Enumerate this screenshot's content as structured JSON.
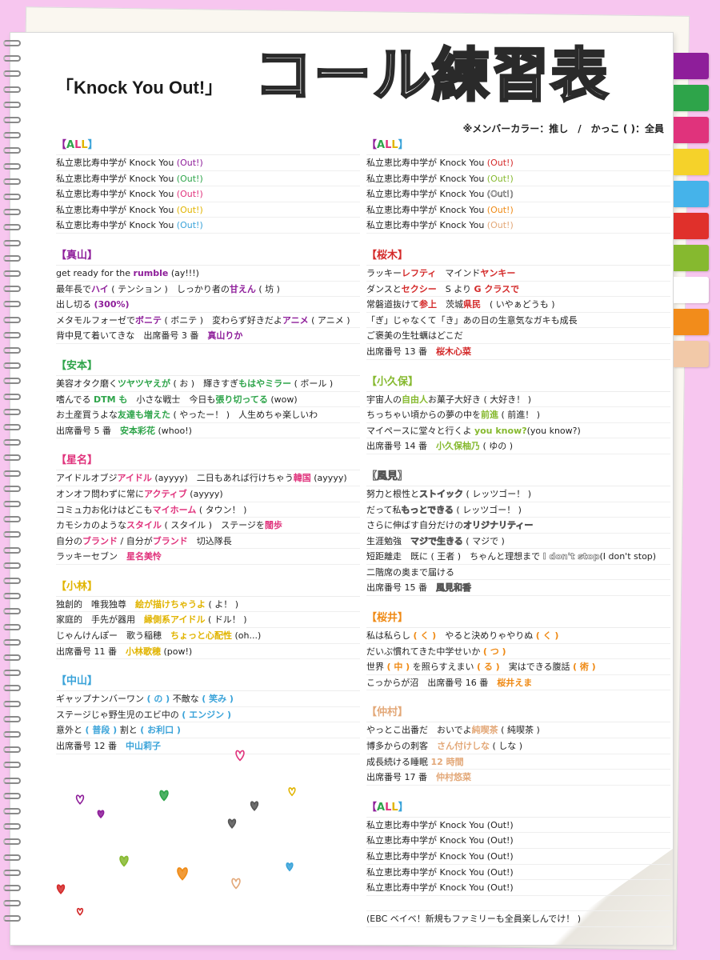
{
  "header": {
    "song": "「Knock You Out!」",
    "title": "コール練習表",
    "note": "※メンバーカラー：推し　/　かっこ ( )：全員"
  },
  "colors": {
    "purple": "#8e1e9a",
    "green": "#2ea44a",
    "pink": "#e0337c",
    "yellow": "#e1b400",
    "sky": "#3aa3d9",
    "red": "#d42a2a",
    "lgreen": "#86b92f",
    "white": "#ffffff",
    "orange": "#ef8a15",
    "peach": "#e3a878"
  },
  "tabs": [
    "#8e1e9a",
    "#2ea44a",
    "#e0337c",
    "#f5d22a",
    "#45b3ea",
    "#e0302b",
    "#86b92f",
    "#ffffff",
    "#f28c1b",
    "#f2c9a8"
  ],
  "left_sections": [
    {
      "title": "【ALL】",
      "title_color": "rainbow",
      "lines": [
        [
          {
            "t": "私立恵比寿中学が Knock You "
          },
          {
            "t": "(Out!)",
            "c": "purple"
          }
        ],
        [
          {
            "t": "私立恵比寿中学が Knock You "
          },
          {
            "t": "(Out!)",
            "c": "green"
          }
        ],
        [
          {
            "t": "私立恵比寿中学が Knock You "
          },
          {
            "t": "(Out!)",
            "c": "pink"
          }
        ],
        [
          {
            "t": "私立恵比寿中学が Knock You "
          },
          {
            "t": "(Out!)",
            "c": "yellow"
          }
        ],
        [
          {
            "t": "私立恵比寿中学が Knock You "
          },
          {
            "t": "(Out!)",
            "c": "sky"
          }
        ]
      ]
    },
    {
      "title": "【真山】",
      "title_color": "purple",
      "lines": [
        [
          {
            "t": "get ready for the "
          },
          {
            "t": "rumble",
            "c": "purple",
            "b": true
          },
          {
            "t": " (ay!!!)"
          }
        ],
        [
          {
            "t": "最年長で"
          },
          {
            "t": "ハイ",
            "c": "purple",
            "b": true
          },
          {
            "t": " ( テンション )　しっかり者の"
          },
          {
            "t": "甘えん",
            "c": "purple",
            "b": true
          },
          {
            "t": " ( 坊 )"
          }
        ],
        [
          {
            "t": "出し切る "
          },
          {
            "t": "(300%)",
            "c": "purple",
            "b": true
          }
        ],
        [
          {
            "t": "メタモルフォーゼで"
          },
          {
            "t": "ボニテ",
            "c": "purple",
            "b": true
          },
          {
            "t": " ( ボニテ )　変わらず好きだよ"
          },
          {
            "t": "アニメ",
            "c": "purple",
            "b": true
          },
          {
            "t": " ( アニメ )"
          }
        ],
        [
          {
            "t": "背中見て着いてきな　出席番号 3 番　"
          },
          {
            "t": "真山りか",
            "c": "purple",
            "b": true
          }
        ]
      ]
    },
    {
      "title": "【安本】",
      "title_color": "green",
      "lines": [
        [
          {
            "t": "美容オタク磨く"
          },
          {
            "t": "ツヤツヤえが",
            "c": "green",
            "b": true
          },
          {
            "t": " ( お )　輝きすぎ"
          },
          {
            "t": "もはやミラー",
            "c": "green",
            "b": true
          },
          {
            "t": " ( ボール )"
          }
        ],
        [
          {
            "t": "嗜んでる "
          },
          {
            "t": "DTM も",
            "c": "green",
            "b": true
          },
          {
            "t": "　小さな戦士　今日も"
          },
          {
            "t": "張り切ってる",
            "c": "green",
            "b": true
          },
          {
            "t": " (wow)"
          }
        ],
        [
          {
            "t": "お土産買うよな"
          },
          {
            "t": "友達も増えた",
            "c": "green",
            "b": true
          },
          {
            "t": " ( やったー！ )　人生めちゃ楽しいわ"
          }
        ],
        [
          {
            "t": "出席番号 5 番　"
          },
          {
            "t": "安本彩花",
            "c": "green",
            "b": true
          },
          {
            "t": " (whoo!)"
          }
        ]
      ]
    },
    {
      "title": "【星名】",
      "title_color": "pink",
      "lines": [
        [
          {
            "t": "アイドルオブジ"
          },
          {
            "t": "アイドル",
            "c": "pink",
            "b": true
          },
          {
            "t": " (ayyyy)　二日もあれば行けちゃう"
          },
          {
            "t": "韓国",
            "c": "pink",
            "b": true
          },
          {
            "t": " (ayyyy)"
          }
        ],
        [
          {
            "t": "オンオフ問わずに常に"
          },
          {
            "t": "アクティブ",
            "c": "pink",
            "b": true
          },
          {
            "t": " (ayyyy)"
          }
        ],
        [
          {
            "t": "コミュ力お化けはどこも"
          },
          {
            "t": "マイホーム",
            "c": "pink",
            "b": true
          },
          {
            "t": " ( タウン！ )"
          }
        ],
        [
          {
            "t": "カモシカのような"
          },
          {
            "t": "スタイル",
            "c": "pink",
            "b": true
          },
          {
            "t": " ( スタイル )　ステージを"
          },
          {
            "t": "闊歩",
            "c": "pink",
            "b": true
          }
        ],
        [
          {
            "t": "自分の"
          },
          {
            "t": "ブランド",
            "c": "pink",
            "b": true
          },
          {
            "t": " / 自分が"
          },
          {
            "t": "ブランド",
            "c": "pink",
            "b": true
          },
          {
            "t": "　切込隊長"
          }
        ],
        [
          {
            "t": "ラッキーセブン　"
          },
          {
            "t": "星名美怜",
            "c": "pink",
            "b": true
          }
        ]
      ]
    },
    {
      "title": "【小林】",
      "title_color": "yellow",
      "lines": [
        [
          {
            "t": "独創的　唯我独尊　"
          },
          {
            "t": "絵が描けちゃうよ",
            "c": "yellow",
            "b": true
          },
          {
            "t": " ( よ！ )"
          }
        ],
        [
          {
            "t": "家庭的　手先が器用　"
          },
          {
            "t": "縁側系アイドル",
            "c": "yellow",
            "b": true
          },
          {
            "t": " ( ドル！ )"
          }
        ],
        [
          {
            "t": "じゃんけんぽー　歌う稲穂　"
          },
          {
            "t": "ちょっと心配性",
            "c": "yellow",
            "b": true
          },
          {
            "t": " (oh...)"
          }
        ],
        [
          {
            "t": "出席番号 11 番　"
          },
          {
            "t": "小林歌穂",
            "c": "yellow",
            "b": true
          },
          {
            "t": " (pow!)"
          }
        ]
      ]
    },
    {
      "title": "【中山】",
      "title_color": "sky",
      "lines": [
        [
          {
            "t": "ギャップナンバーワン "
          },
          {
            "t": "( の )",
            "c": "sky",
            "b": true
          },
          {
            "t": " 不敵な "
          },
          {
            "t": "( 笑み )",
            "c": "sky",
            "b": true
          }
        ],
        [
          {
            "t": "ステージじゃ野生児のエビ中の "
          },
          {
            "t": "( エンジン )",
            "c": "sky",
            "b": true
          }
        ],
        [
          {
            "t": "意外と "
          },
          {
            "t": "( 普段 )",
            "c": "sky",
            "b": true
          },
          {
            "t": " 割と "
          },
          {
            "t": "( お利口 )",
            "c": "sky",
            "b": true
          }
        ],
        [
          {
            "t": "出席番号 12 番　"
          },
          {
            "t": "中山莉子",
            "c": "sky",
            "b": true
          }
        ]
      ]
    }
  ],
  "right_sections": [
    {
      "title": "【ALL】",
      "title_color": "rainbow",
      "lines": [
        [
          {
            "t": "私立恵比寿中学が Knock You "
          },
          {
            "t": "(Out!)",
            "c": "red"
          }
        ],
        [
          {
            "t": "私立恵比寿中学が Knock You "
          },
          {
            "t": "(Out!)",
            "c": "lgreen"
          }
        ],
        [
          {
            "t": "私立恵比寿中学が Knock You "
          },
          {
            "t": "(Out!)",
            "c": "white"
          }
        ],
        [
          {
            "t": "私立恵比寿中学が Knock You "
          },
          {
            "t": "(Out!)",
            "c": "orange"
          }
        ],
        [
          {
            "t": "私立恵比寿中学が Knock You "
          },
          {
            "t": "(Out!)",
            "c": "peach"
          }
        ]
      ]
    },
    {
      "title": "【桜木】",
      "title_color": "red",
      "lines": [
        [
          {
            "t": "ラッキー"
          },
          {
            "t": "レフティ",
            "c": "red",
            "b": true
          },
          {
            "t": "　マインド"
          },
          {
            "t": "ヤンキー",
            "c": "red",
            "b": true
          }
        ],
        [
          {
            "t": "ダンスと"
          },
          {
            "t": "セクシー",
            "c": "red",
            "b": true
          },
          {
            "t": "　S より "
          },
          {
            "t": "G クラスで",
            "c": "red",
            "b": true
          }
        ],
        [
          {
            "t": "常磐道抜けて"
          },
          {
            "t": "参上",
            "c": "red",
            "b": true
          },
          {
            "t": "　茨城"
          },
          {
            "t": "県民",
            "c": "red",
            "b": true
          },
          {
            "t": "　( いやぁどうも )"
          }
        ],
        [
          {
            "t": "「ぎ」じゃなくて「き」あの日の生意気なガキも成長"
          }
        ],
        [
          {
            "t": "ご褒美の生牡蠣はどこだ"
          }
        ],
        [
          {
            "t": "出席番号 13 番　"
          },
          {
            "t": "桜木心菜",
            "c": "red",
            "b": true
          }
        ]
      ]
    },
    {
      "title": "【小久保】",
      "title_color": "lgreen",
      "lines": [
        [
          {
            "t": "宇宙人の"
          },
          {
            "t": "自由人",
            "c": "lgreen",
            "b": true
          },
          {
            "t": "お菓子大好き ( 大好き！ )"
          }
        ],
        [
          {
            "t": "ちっちゃい頃からの夢の中を"
          },
          {
            "t": "前進",
            "c": "lgreen",
            "b": true
          },
          {
            "t": " ( 前進！ )"
          }
        ],
        [
          {
            "t": "マイペースに堂々と行くよ "
          },
          {
            "t": "you know?",
            "c": "lgreen",
            "b": true
          },
          {
            "t": "(you know?)"
          }
        ],
        [
          {
            "t": "出席番号 14 番　"
          },
          {
            "t": "小久保柚乃",
            "c": "lgreen",
            "b": true
          },
          {
            "t": " ( ゆの )"
          }
        ]
      ]
    },
    {
      "title": "【風見】",
      "title_color": "white",
      "lines": [
        [
          {
            "t": "努力と根性と"
          },
          {
            "t": "ストイック",
            "c": "white",
            "b": true
          },
          {
            "t": " ( レッツゴー！ )"
          }
        ],
        [
          {
            "t": "だって私"
          },
          {
            "t": "もっとできる",
            "c": "white",
            "b": true
          },
          {
            "t": " ( レッツゴー！ )"
          }
        ],
        [
          {
            "t": "さらに伸ばす自分だけの"
          },
          {
            "t": "オリジナリティー",
            "c": "white",
            "b": true
          }
        ],
        [
          {
            "t": "生涯勉強　"
          },
          {
            "t": "マジで生きる",
            "c": "white",
            "b": true
          },
          {
            "t": " ( マジで )"
          }
        ],
        [
          {
            "t": "短距離走　既に ( 王者 )　ちゃんと理想まで "
          },
          {
            "t": "I don't stop",
            "c": "white",
            "b": true
          },
          {
            "t": "(I don't stop)"
          }
        ],
        [
          {
            "t": "二階席の奥まで届ける"
          }
        ],
        [
          {
            "t": "出席番号 15 番　"
          },
          {
            "t": "風見和香",
            "c": "white",
            "b": true
          }
        ]
      ]
    },
    {
      "title": "【桜井】",
      "title_color": "orange",
      "lines": [
        [
          {
            "t": "私は私らし "
          },
          {
            "t": "( く )",
            "c": "orange",
            "b": true
          },
          {
            "t": "　やると決めりゃやりぬ "
          },
          {
            "t": "( く )",
            "c": "orange",
            "b": true
          }
        ],
        [
          {
            "t": "だいぶ慣れてきた中学せいか "
          },
          {
            "t": "( つ )",
            "c": "orange",
            "b": true
          }
        ],
        [
          {
            "t": "世界 "
          },
          {
            "t": "( 中 )",
            "c": "orange",
            "b": true
          },
          {
            "t": " を照らすえまい "
          },
          {
            "t": "( る )",
            "c": "orange",
            "b": true
          },
          {
            "t": "　実はできる腹話 "
          },
          {
            "t": "( 術 )",
            "c": "orange",
            "b": true
          }
        ],
        [
          {
            "t": "こっからが沼　出席番号 16 番　"
          },
          {
            "t": "桜井えま",
            "c": "orange",
            "b": true
          }
        ]
      ]
    },
    {
      "title": "【仲村】",
      "title_color": "peach",
      "lines": [
        [
          {
            "t": "やっとこ出番だ　おいでよ"
          },
          {
            "t": "純喫茶",
            "c": "peach",
            "b": true
          },
          {
            "t": " ( 純喫茶 )"
          }
        ],
        [
          {
            "t": "博多からの刺客　"
          },
          {
            "t": "さん付けしな",
            "c": "peach",
            "b": true
          },
          {
            "t": " ( しな )"
          }
        ],
        [
          {
            "t": "成長続ける睡眠 "
          },
          {
            "t": "12 時間",
            "c": "peach",
            "b": true
          }
        ],
        [
          {
            "t": "出席番号 17 番　"
          },
          {
            "t": "仲村悠菜",
            "c": "peach",
            "b": true
          }
        ]
      ]
    },
    {
      "title": "【ALL】",
      "title_color": "rainbow",
      "lines": [
        [
          {
            "t": "私立恵比寿中学が Knock You (Out!)"
          }
        ],
        [
          {
            "t": "私立恵比寿中学が Knock You (Out!)"
          }
        ],
        [
          {
            "t": "私立恵比寿中学が Knock You (Out!)"
          }
        ],
        [
          {
            "t": "私立恵比寿中学が Knock You (Out!)"
          }
        ],
        [
          {
            "t": "私立恵比寿中学が Knock You (Out!)"
          }
        ],
        [
          {
            "t": ""
          }
        ],
        [
          {
            "t": "(EBC ベイベ！新規もファミリーも全員楽しんでけ！ )"
          }
        ]
      ]
    }
  ],
  "doodles": [
    {
      "icon": "heart-icon",
      "color": "#8e1e9a"
    },
    {
      "icon": "heart-icon",
      "color": "#8e1e9a"
    },
    {
      "icon": "heart-icon",
      "color": "#2ea44a"
    },
    {
      "icon": "heart-icon",
      "color": "#e0337c"
    },
    {
      "icon": "heart-icon",
      "color": "#555555"
    },
    {
      "icon": "heart-icon",
      "color": "#555555"
    },
    {
      "icon": "heart-icon",
      "color": "#e1b400"
    },
    {
      "icon": "heart-icon",
      "color": "#86b92f"
    },
    {
      "icon": "heart-icon",
      "color": "#ef8a15"
    },
    {
      "icon": "heart-icon",
      "color": "#e3a878"
    },
    {
      "icon": "heart-icon",
      "color": "#3aa3d9"
    },
    {
      "icon": "heart-icon",
      "color": "#d42a2a"
    },
    {
      "icon": "heart-icon",
      "color": "#d42a2a"
    }
  ]
}
